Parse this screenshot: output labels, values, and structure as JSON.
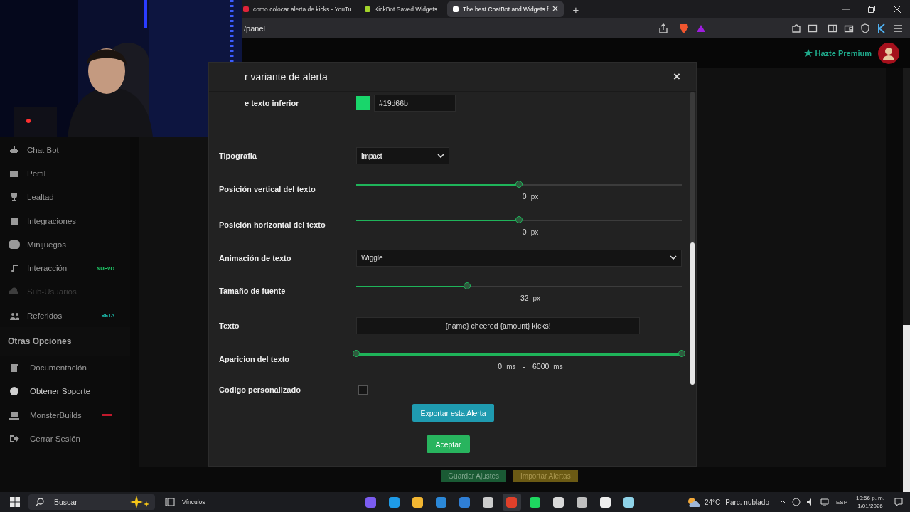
{
  "browser": {
    "tabs": [
      {
        "title": "como colocar alerta de kicks - YouTu",
        "selected": false,
        "color": "#e0243a"
      },
      {
        "title": "KickBot Saved Widgets",
        "selected": false,
        "color": "#a3d42b"
      },
      {
        "title": "The best ChatBot and Widgets f",
        "selected": true,
        "color": "#ffffff"
      }
    ],
    "new_tab": "+",
    "address": "/panel"
  },
  "header": {
    "premium": "Hazte Premium"
  },
  "sidebar": {
    "items": [
      {
        "label": "Chat Bot",
        "disabled": false,
        "selected": false
      },
      {
        "label": "Perfil",
        "disabled": false,
        "selected": false
      },
      {
        "label": "Lealtad",
        "disabled": false,
        "selected": false
      },
      {
        "label": "Integraciones",
        "disabled": false,
        "selected": false
      },
      {
        "label": "Minijuegos",
        "disabled": false,
        "selected": false
      },
      {
        "label": "Interacción",
        "disabled": false,
        "selected": false,
        "badge": {
          "text": "NUEVO",
          "color": "#1fcf6a"
        }
      },
      {
        "label": "Sub-Usuarios",
        "disabled": true,
        "selected": false
      },
      {
        "label": "Referidos",
        "disabled": false,
        "selected": false,
        "badge": {
          "text": "BETA",
          "color": "#1aa89a"
        }
      }
    ],
    "section": "Otras Opciones",
    "other_items": [
      {
        "label": "Documentación",
        "disabled": false,
        "selected": false
      },
      {
        "label": "Obtener Soporte",
        "disabled": false,
        "selected": true
      },
      {
        "label": "MonsterBuilds",
        "disabled": false,
        "selected": false,
        "badge": {
          "color": "#c0192c"
        }
      },
      {
        "label": "Cerrar Sesión",
        "disabled": false,
        "selected": false
      }
    ]
  },
  "background_buttons": [
    "Guardar Ajustes",
    "Importar Alertas"
  ],
  "modal": {
    "title": "r variante de alerta",
    "close": "×",
    "fields": [
      {
        "kind": "color",
        "label": "e texto inferior",
        "value": "#19d66b"
      },
      {
        "kind": "select",
        "label": "Tipografia",
        "value": "Impact",
        "wide": false
      },
      {
        "kind": "slider",
        "label": "Posición vertical del texto",
        "level": 0.5,
        "reading": "0",
        "unit": "px"
      },
      {
        "kind": "slider",
        "label": "Posición horizontal del texto",
        "level": 0.5,
        "reading": "0",
        "unit": "px"
      },
      {
        "kind": "select",
        "label": "Animación de texto",
        "value": "Wiggle",
        "wide": true
      },
      {
        "kind": "slider",
        "label": "Tamaño de fuente",
        "level": 0.34,
        "reading": "32",
        "unit": "px"
      },
      {
        "kind": "text",
        "label": "Texto",
        "value": "{name} cheered {amount} kicks!"
      },
      {
        "kind": "range",
        "label": "Aparicion del texto",
        "thumbs": [
          {
            "level": 0,
            "reading": "0",
            "unit": "ms"
          },
          {
            "level": 1,
            "reading": "6000",
            "unit": "ms"
          }
        ],
        "separator": "-"
      },
      {
        "kind": "checkbox",
        "label": "Codigo personalizado",
        "checked": false
      }
    ],
    "export_button": "Exportar esta Alerta",
    "accept_button": "Aceptar"
  },
  "taskbar": {
    "search": "Buscar",
    "links": "Vínculos",
    "apps": [
      {
        "color": "#7b5cf0",
        "selected": false
      },
      {
        "color": "#1e9be8",
        "selected": false
      },
      {
        "color": "#f2b632",
        "selected": false
      },
      {
        "color": "#2b88d8",
        "selected": false
      },
      {
        "color": "#2f7fd6",
        "selected": false
      },
      {
        "color": "#cccccc",
        "selected": false
      },
      {
        "color": "#e0402a",
        "selected": true
      },
      {
        "color": "#1ed760",
        "selected": false
      },
      {
        "color": "#d9d9d9",
        "selected": false
      },
      {
        "color": "#bfbfbf",
        "selected": false
      },
      {
        "color": "#eeeeee",
        "selected": false
      },
      {
        "color": "#8fd3e8",
        "selected": false
      }
    ],
    "weather": {
      "temp": "24°C",
      "desc": "Parc. nublado"
    },
    "language": "ESP",
    "time": "10:56 p. m.",
    "date": "1/01/2026"
  }
}
